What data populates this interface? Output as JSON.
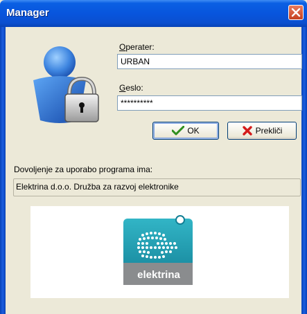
{
  "window": {
    "title": "Manager"
  },
  "icons": {
    "user_lock": "user-lock-icon",
    "close": "close-icon",
    "ok": "checkmark-icon",
    "cancel": "red-x-icon"
  },
  "form": {
    "operator_label_accel": "O",
    "operator_label_rest": "perater:",
    "operator_value": "URBAN",
    "password_label_accel": "G",
    "password_label_rest": "eslo:",
    "password_value": "**********"
  },
  "buttons": {
    "ok": "OK",
    "cancel": "Prekliči"
  },
  "license": {
    "label": "Dovoljenje za uporabo programa ima:",
    "holder": "Elektrina d.o.o. Družba za razvoj elektronike"
  },
  "logo": {
    "text": "elektrina"
  },
  "colors": {
    "titlebar": "#0855dd",
    "dialog_bg": "#ece9d8",
    "logo_teal": "#1a95aa",
    "logo_gray": "#8a8c8e"
  }
}
